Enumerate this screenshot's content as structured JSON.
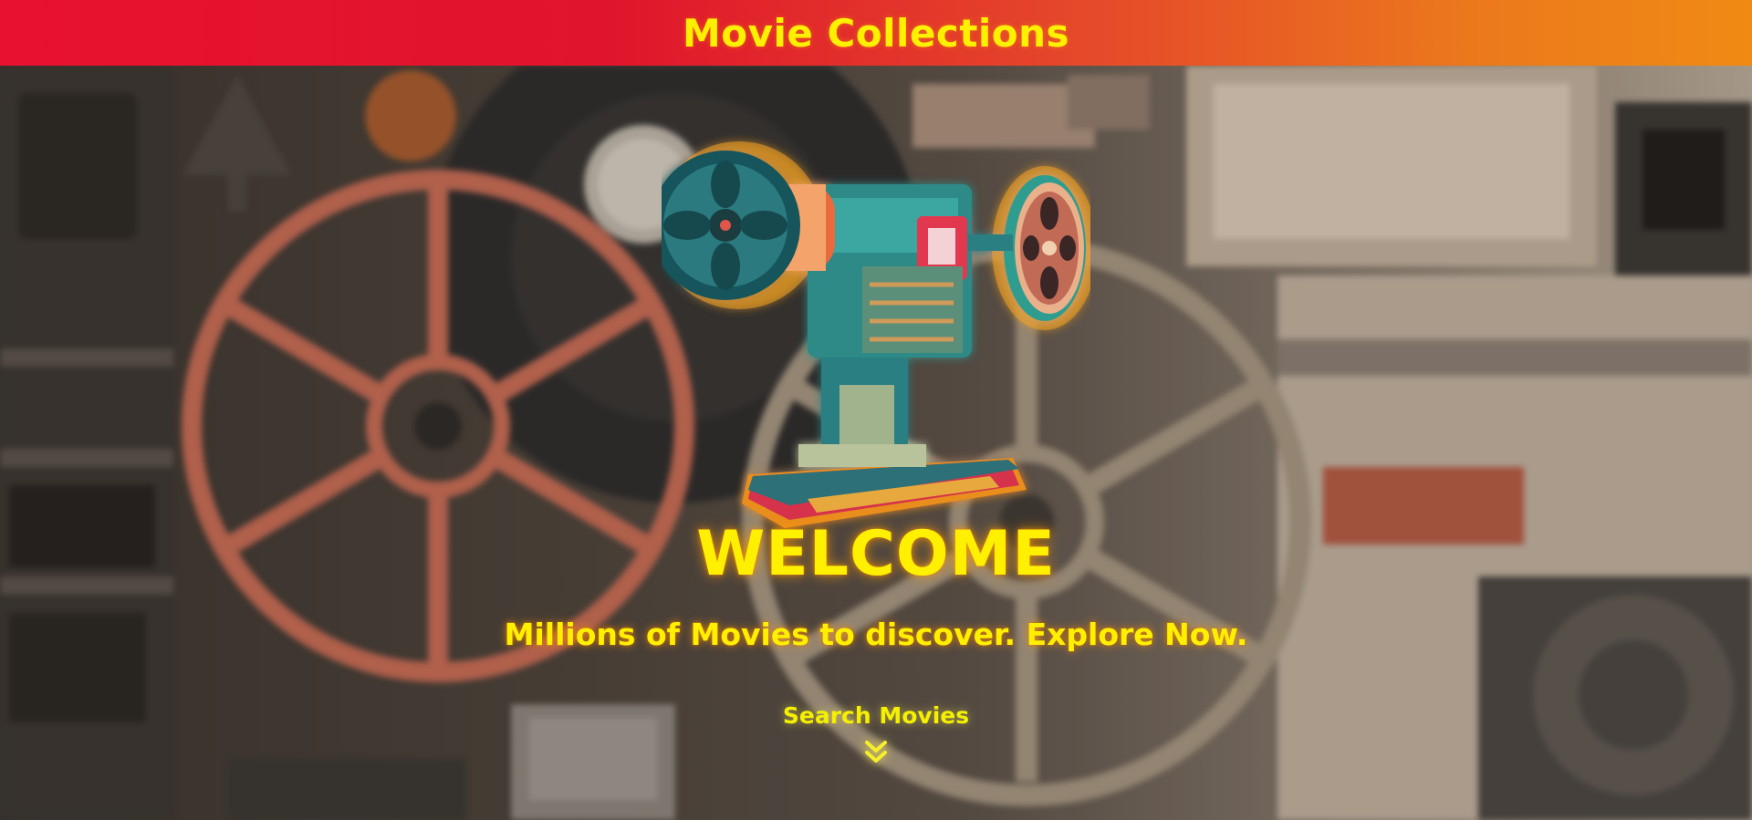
{
  "header": {
    "title": "Movie Collections"
  },
  "hero": {
    "welcome": "WELCOME",
    "tagline": "Millions of Movies to discover. Explore Now.",
    "search_label": "Search Movies",
    "scroll_icon": "double-chevron-down-icon",
    "hero_image": "film-projector-illustration"
  },
  "colors": {
    "header_gradient_start": "#e8112f",
    "header_gradient_end": "#f08a14",
    "accent_text": "#fff000",
    "glow": "#ff9a00"
  }
}
